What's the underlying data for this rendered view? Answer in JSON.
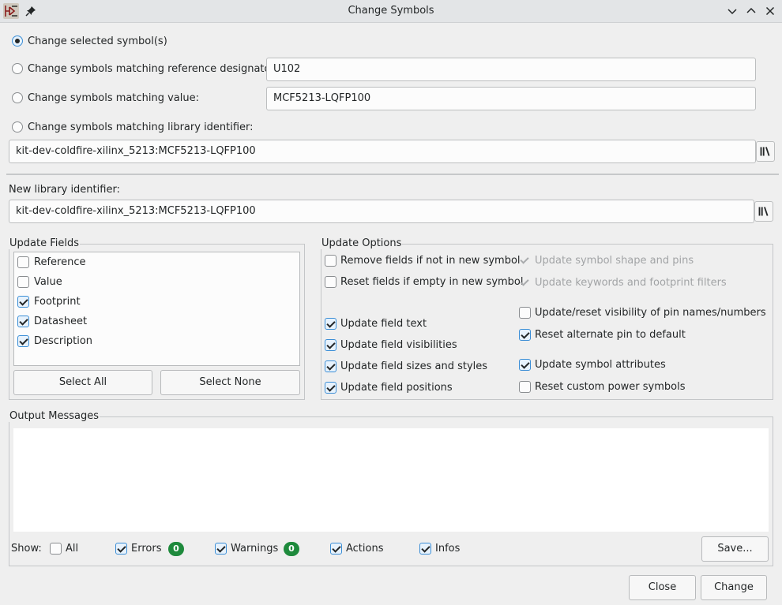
{
  "window": {
    "title": "Change Symbols",
    "icons": {
      "app": "kicad-symbol-icon",
      "pin": "pin-icon",
      "minimize": "chevron-down-icon",
      "maximize": "chevron-up-icon",
      "close": "close-icon"
    }
  },
  "scope": {
    "selected": {
      "label": "Change selected symbol(s)",
      "checked": true
    },
    "by_reference": {
      "label": "Change symbols matching reference designator:",
      "value": "U102",
      "checked": false
    },
    "by_value": {
      "label": "Change symbols matching value:",
      "value": "MCF5213-LQFP100",
      "checked": false
    },
    "by_lib_id": {
      "label": "Change symbols matching library identifier:",
      "value": "kit-dev-coldfire-xilinx_5213:MCF5213-LQFP100",
      "checked": false
    }
  },
  "new_lib": {
    "label": "New library identifier:",
    "value": "kit-dev-coldfire-xilinx_5213:MCF5213-LQFP100"
  },
  "update_fields": {
    "title": "Update Fields",
    "items": [
      {
        "label": "Reference",
        "checked": false
      },
      {
        "label": "Value",
        "checked": false
      },
      {
        "label": "Footprint",
        "checked": true
      },
      {
        "label": "Datasheet",
        "checked": true
      },
      {
        "label": "Description",
        "checked": true
      }
    ],
    "select_all": "Select All",
    "select_none": "Select None"
  },
  "update_options": {
    "title": "Update Options",
    "remove_fields": "Remove fields if not in new symbol",
    "reset_empty": "Reset fields if empty in new symbol",
    "field_text": "Update field text",
    "field_visibilities": "Update field visibilities",
    "field_sizes": "Update field sizes and styles",
    "field_positions": "Update field positions",
    "symbol_shape": "Update symbol shape and pins",
    "keywords": "Update keywords and footprint filters",
    "pin_visibility": "Update/reset visibility of pin names/numbers",
    "alt_pin": "Reset alternate pin to default",
    "symbol_attributes": "Update symbol attributes",
    "power_symbols": "Reset custom power symbols"
  },
  "output": {
    "title": "Output Messages",
    "show_label": "Show:",
    "all": "All",
    "errors": "Errors",
    "errors_count": "0",
    "warnings": "Warnings",
    "warnings_count": "0",
    "actions": "Actions",
    "infos": "Infos",
    "save": "Save..."
  },
  "footer": {
    "close": "Close",
    "change": "Change"
  },
  "colors": {
    "accent": "#3b8ed6",
    "badge": "#1e8a3c"
  }
}
